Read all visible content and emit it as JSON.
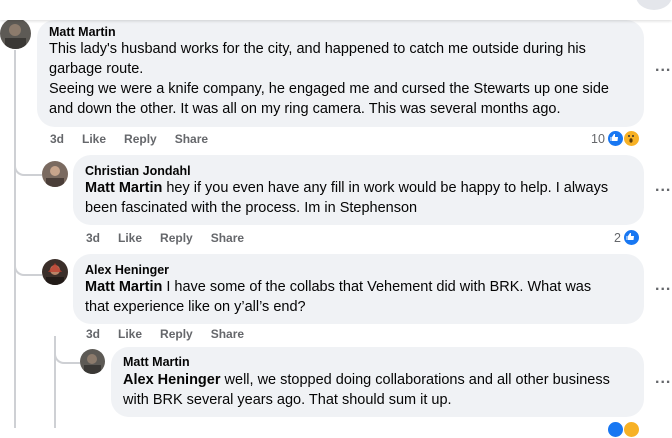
{
  "comments": [
    {
      "author": "Matt Martin",
      "line1": "This lady's husband works for the city, and happened to catch me outside during his",
      "line2": "garbage route.",
      "line3": "Seeing we were a knife company, he engaged me and cursed the Stewarts up one side",
      "line4": "and down the other. It was all on my ring camera. This was several months ago.",
      "time": "3d",
      "like": "Like",
      "reply": "Reply",
      "share": "Share",
      "reactions": "10"
    },
    {
      "author": "Christian Jondahl",
      "mention": "Matt Martin",
      "line1": " hey if you even have any fill in work would be happy to help. I always",
      "line2": "been fascinated with the process. Im in Stephenson",
      "time": "3d",
      "like": "Like",
      "reply": "Reply",
      "share": "Share",
      "reactions": "2"
    },
    {
      "author": "Alex Heninger",
      "mention": "Matt Martin",
      "line1": " I have some of the collabs that Vehement did with BRK. What was",
      "line2": "that experience like on y’all’s end?",
      "time": "3d",
      "like": "Like",
      "reply": "Reply",
      "share": "Share"
    },
    {
      "author": "Matt Martin",
      "mention": "Alex Heninger",
      "line1": " well, we stopped doing collaborations and all other business",
      "line2": "with BRK several years ago. That should sum it up."
    }
  ],
  "more_glyph": "...",
  "icons": {
    "like": "like-reaction-icon",
    "wow": "wow-reaction-icon",
    "more": "more-options-icon"
  },
  "colors": {
    "bubble": "#f0f2f5",
    "like_blue": "#1877f2",
    "wow_yellow": "#f7b125",
    "meta_gray": "#65676b"
  }
}
